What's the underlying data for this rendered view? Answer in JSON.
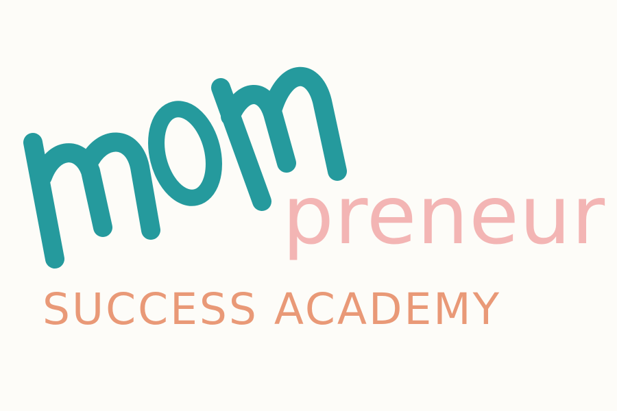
{
  "brand": {
    "mom_word": "mom",
    "preneur_word": "preneur",
    "tagline": "SUCCESS ACADEMY"
  },
  "colors": {
    "background": "#fdfcf8",
    "teal": "#259a9d",
    "pink": "#f3b5b4",
    "peach": "#e99977"
  }
}
